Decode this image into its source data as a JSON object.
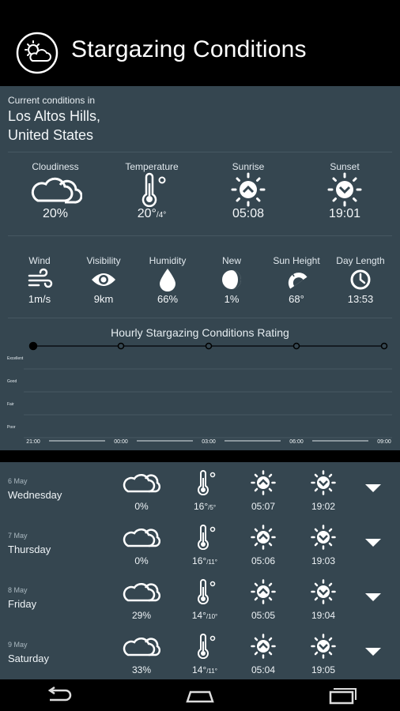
{
  "header": {
    "title": "Stargazing Conditions",
    "logo_icon": "weather-app-logo-icon"
  },
  "current": {
    "location_label": "Current conditions in",
    "location_line1": "Los Altos Hills,",
    "location_line2": "United States",
    "row1": [
      {
        "key": "cloudiness",
        "label": "Cloudiness",
        "value": "20%",
        "icon": "cloud-icon"
      },
      {
        "key": "temperature",
        "label": "Temperature",
        "value": "20°",
        "value_small": "/4°",
        "icon": "thermometer-icon"
      },
      {
        "key": "sunrise",
        "label": "Sunrise",
        "value": "05:08",
        "icon": "sunrise-icon"
      },
      {
        "key": "sunset",
        "label": "Sunset",
        "value": "19:01",
        "icon": "sunset-icon"
      }
    ],
    "row2": [
      {
        "key": "wind",
        "label": "Wind",
        "value": "1m/s",
        "icon": "wind-icon"
      },
      {
        "key": "visibility",
        "label": "Visibility",
        "value": "9km",
        "icon": "eye-icon"
      },
      {
        "key": "humidity",
        "label": "Humidity",
        "value": "66%",
        "icon": "droplet-icon"
      },
      {
        "key": "moon",
        "label": "New",
        "value": "1%",
        "icon": "moon-phase-icon"
      },
      {
        "key": "sun-height",
        "label": "Sun Height",
        "value": "68°",
        "icon": "protractor-icon"
      },
      {
        "key": "day-length",
        "label": "Day Length",
        "value": "13:53",
        "icon": "clock-icon"
      }
    ]
  },
  "chart_data": {
    "type": "line",
    "title": "Hourly Stargazing Conditions Rating",
    "categories": [
      "Poor",
      "Fair",
      "Good",
      "Excellent"
    ],
    "x": [
      "21:00",
      "00:00",
      "03:00",
      "06:00",
      "09:00"
    ],
    "series": [
      {
        "values": [
          "Excellent",
          "Excellent",
          "Excellent",
          "Excellent",
          "Excellent"
        ]
      }
    ]
  },
  "forecast": [
    {
      "date": "6 May",
      "day": "Wednesday",
      "cloud": "0%",
      "temp": "16°",
      "temp_small": "/5°",
      "sunrise": "05:07",
      "sunset": "19:02"
    },
    {
      "date": "7 May",
      "day": "Thursday",
      "cloud": "0%",
      "temp": "16°",
      "temp_small": "/11°",
      "sunrise": "05:06",
      "sunset": "19:03"
    },
    {
      "date": "8 May",
      "day": "Friday",
      "cloud": "29%",
      "temp": "14°",
      "temp_small": "/10°",
      "sunrise": "05:05",
      "sunset": "19:04"
    },
    {
      "date": "9 May",
      "day": "Saturday",
      "cloud": "33%",
      "temp": "14°",
      "temp_small": "/11°",
      "sunrise": "05:04",
      "sunset": "19:05"
    }
  ],
  "navbar": {
    "back_icon": "back-icon",
    "home_icon": "home-icon",
    "recents_icon": "recents-icon"
  },
  "colors": {
    "panel": "#354650",
    "header": "#000000",
    "text": "#ffffff"
  }
}
